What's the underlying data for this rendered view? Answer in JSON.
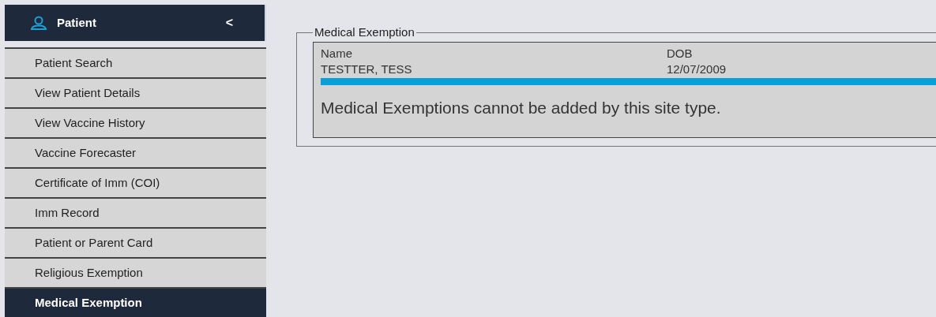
{
  "sidebar": {
    "header": {
      "title": "Patient",
      "collapse": "<"
    },
    "items": [
      {
        "label": "Patient Search",
        "selected": false
      },
      {
        "label": "View Patient Details",
        "selected": false
      },
      {
        "label": "View Vaccine History",
        "selected": false
      },
      {
        "label": "Vaccine Forecaster",
        "selected": false
      },
      {
        "label": "Certificate of Imm (COI)",
        "selected": false
      },
      {
        "label": "Imm Record",
        "selected": false
      },
      {
        "label": "Patient or Parent Card",
        "selected": false
      },
      {
        "label": "Religious Exemption",
        "selected": false
      },
      {
        "label": "Medical Exemption",
        "selected": true
      }
    ]
  },
  "panel": {
    "legend": "Medical Exemption",
    "columns": [
      "Name",
      "DOB"
    ],
    "row": [
      "TESTTER, TESS",
      "12/07/2009"
    ],
    "message": "Medical Exemptions cannot be added by this site type."
  }
}
